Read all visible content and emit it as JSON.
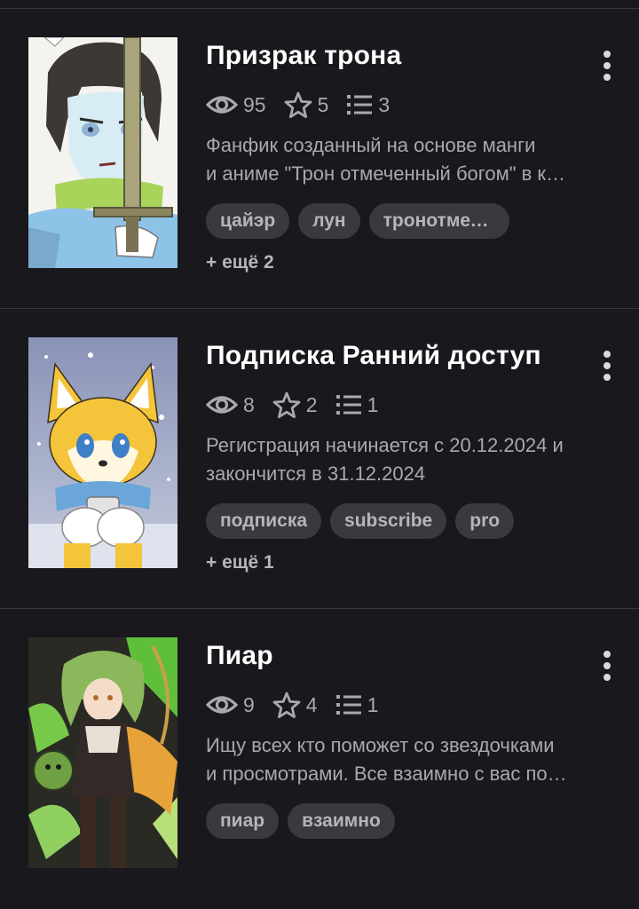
{
  "works": [
    {
      "title": "Призрак трона",
      "views": "95",
      "likes": "5",
      "chapters": "3",
      "description_lines": [
        "Фанфик созданный на основе манги",
        "и аниме \"Трон отмеченный богом\" в к…"
      ],
      "tags": [
        "цайэр",
        "лун",
        "тронотмеч…"
      ],
      "more_tags": "+ ещё 2",
      "cover_icon": "anime-boy-with-sword-cover"
    },
    {
      "title": "Подписка Ранний доступ",
      "views": "8",
      "likes": "2",
      "chapters": "1",
      "description_lines": [
        "Регистрация начинается с 20.12.2024 и",
        "закончится в 31.12.2024"
      ],
      "tags": [
        "подписка",
        "subscribe",
        "pro"
      ],
      "more_tags": "+ ещё 1",
      "cover_icon": "yellow-fox-cover"
    },
    {
      "title": "Пиар",
      "views": "9",
      "likes": "4",
      "chapters": "1",
      "description_lines": [
        "Ищу всех кто поможет со звездочками",
        "и просмотрами. Все взаимно с вас по…"
      ],
      "tags": [
        "пиар",
        "взаимно"
      ],
      "more_tags": "",
      "cover_icon": "green-haired-archer-cover"
    }
  ],
  "icons": {
    "views": "eye-icon",
    "likes": "star-icon",
    "chapters": "list-icon",
    "menu": "more-vertical-icon"
  },
  "colors": {
    "background": "#19181d",
    "divider": "#38373d",
    "title": "#ffffff",
    "meta_text": "#a9a8ae",
    "tag_background": "#3a393f",
    "tag_text": "#b6b5bb"
  }
}
